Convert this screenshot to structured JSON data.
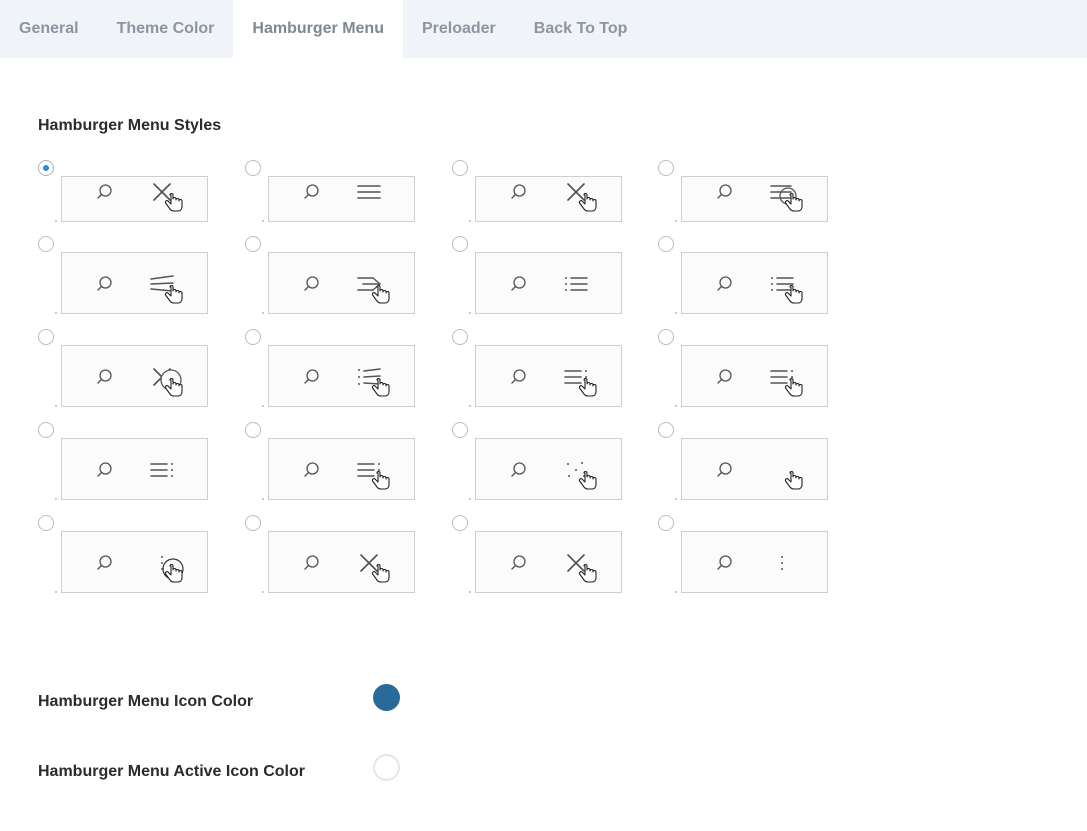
{
  "tabs": [
    {
      "label": "General"
    },
    {
      "label": "Theme Color"
    },
    {
      "label": "Hamburger Menu"
    },
    {
      "label": "Preloader"
    },
    {
      "label": "Back To Top"
    }
  ],
  "active_tab": "Hamburger Menu",
  "styles_section": {
    "title": "Hamburger Menu Styles",
    "selected_index": 0,
    "options": [
      {
        "icon": "close-x-icon",
        "cursor": "pointer-hand"
      },
      {
        "icon": "hamburger-three-lines-icon",
        "cursor": "none"
      },
      {
        "icon": "close-x-icon",
        "cursor": "pointer-hand"
      },
      {
        "icon": "hamburger-circle-icon",
        "cursor": "pointer-hand"
      },
      {
        "icon": "slanted-lines-icon",
        "cursor": "pointer-hand"
      },
      {
        "icon": "arrow-lines-icon",
        "cursor": "pointer-hand"
      },
      {
        "icon": "list-bullets-icon",
        "cursor": "none"
      },
      {
        "icon": "list-bullets-icon",
        "cursor": "pointer-hand"
      },
      {
        "icon": "close-x-circle-icon",
        "cursor": "pointer-hand"
      },
      {
        "icon": "list-slanted-icon",
        "cursor": "pointer-hand"
      },
      {
        "icon": "lines-dots-right-icon",
        "cursor": "pointer-hand"
      },
      {
        "icon": "lines-dots-right-icon",
        "cursor": "pointer-hand"
      },
      {
        "icon": "lines-dots-right-icon",
        "cursor": "none"
      },
      {
        "icon": "lines-dots-right-icon",
        "cursor": "pointer-hand"
      },
      {
        "icon": "scattered-dots-icon",
        "cursor": "pointer-hand"
      },
      {
        "icon": "blank-icon",
        "cursor": "pointer-hand"
      },
      {
        "icon": "vertical-dots-icon",
        "cursor": "circle-pointer"
      },
      {
        "icon": "close-x-icon",
        "cursor": "pointer-hand"
      },
      {
        "icon": "close-x-icon",
        "cursor": "pointer-hand"
      },
      {
        "icon": "vertical-dots-icon",
        "cursor": "none"
      }
    ]
  },
  "icon_color": {
    "label": "Hamburger Menu Icon Color",
    "value": "#2a6a98"
  },
  "active_icon_color": {
    "label": "Hamburger Menu Active Icon Color",
    "value": "#ffffff"
  },
  "colors": {
    "tab_bar_bg": "#f0f3f8",
    "radio_selected": "#2e8bd6",
    "icon_stroke": "#555555"
  }
}
